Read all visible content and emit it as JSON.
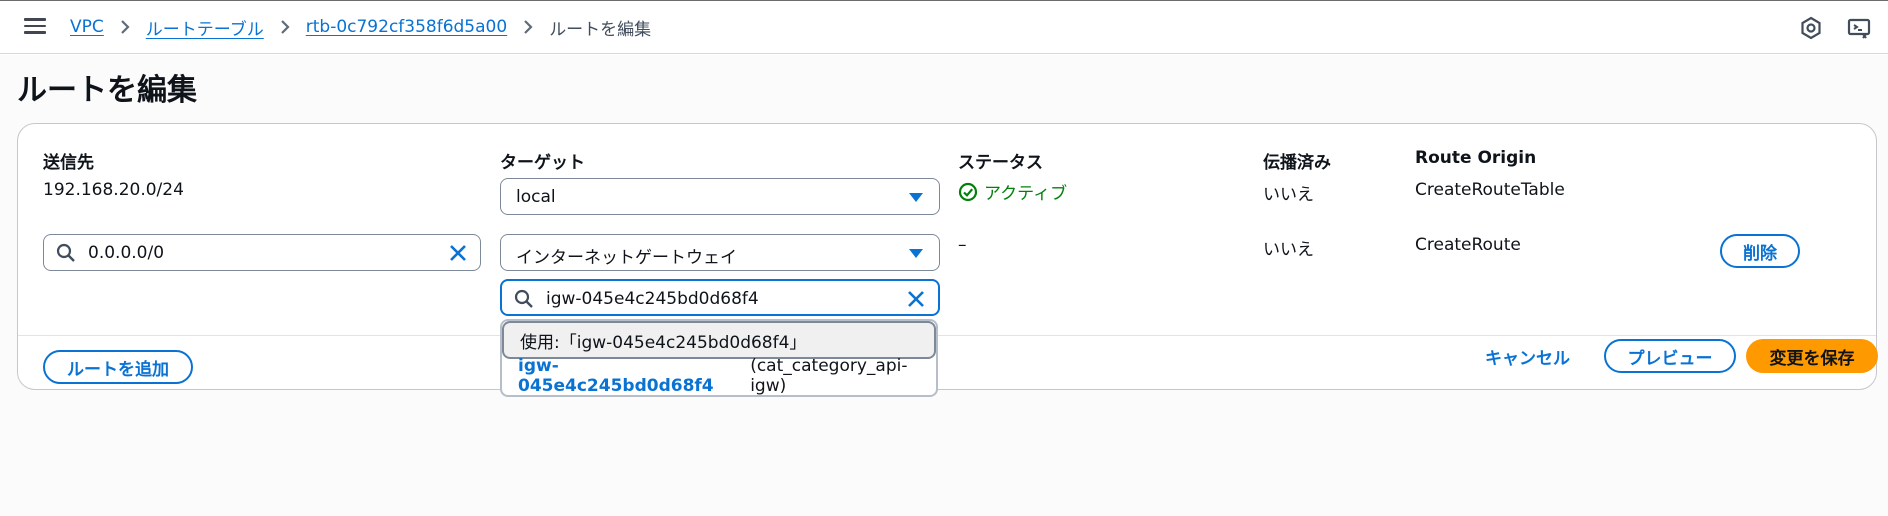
{
  "breadcrumb": {
    "items": [
      "VPC",
      "ルートテーブル",
      "rtb-0c792cf358f6d5a00"
    ],
    "current": "ルートを編集"
  },
  "page_title": "ルートを編集",
  "columns": {
    "destination": "送信先",
    "target": "ターゲット",
    "status": "ステータス",
    "propagated": "伝播済み",
    "origin": "Route Origin"
  },
  "routes": [
    {
      "destination": "192.168.20.0/24",
      "target": "local",
      "status": "アクティブ",
      "propagated": "いいえ",
      "origin": "CreateRouteTable"
    },
    {
      "destination": "0.0.0.0/0",
      "target": "インターネットゲートウェイ",
      "target_search": "igw-045e4c245bd0d68f4",
      "status": "–",
      "propagated": "いいえ",
      "origin": "CreateRoute",
      "remove_label": "削除"
    }
  ],
  "dropdown": {
    "use_option": "使用:「igw-045e4c245bd0d68f4」",
    "option_id": "igw-045e4c245bd0d68f4",
    "option_name": "(cat_category_api-igw)"
  },
  "buttons": {
    "add_route": "ルートを追加",
    "cancel": "キャンセル",
    "preview": "プレビュー",
    "save": "変更を保存"
  },
  "colors": {
    "link": "#0972d3",
    "success": "#037f0c",
    "primary_button": "#ff9900"
  }
}
